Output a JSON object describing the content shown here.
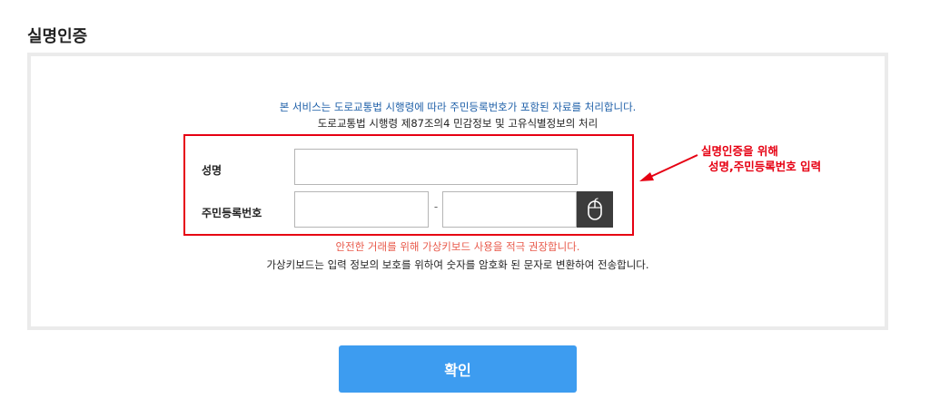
{
  "page": {
    "title": "실명인증"
  },
  "notice": {
    "line1": "본 서비스는 도로교통법 시행령에 따라 주민등록번호가 포함된 자료를 처리합니다.",
    "line2": "도로교통법 시행령 제87조의4 민감정보 및 고유식별정보의 처리"
  },
  "form": {
    "name_label": "성명",
    "name_value": "",
    "rrn_label": "주민등록번호",
    "rrn_front_value": "",
    "rrn_back_value": "",
    "separator": "-",
    "keypad_icon": "mouse-icon"
  },
  "warning": "안전한 거래를 위해 가상키보드 사용을 적극 권장합니다.",
  "info": "가상키보드는 입력 정보의 보호를 위하여 숫자를 암호화 된 문자로 변환하여 전송합니다.",
  "annotation": {
    "line1": "실명인증을 위해",
    "line2": "성명,주민등록번호 입력"
  },
  "confirm_label": "확인",
  "colors": {
    "accent_red": "#e60012",
    "warning_red": "#e8594a",
    "notice_blue": "#1e5fa8",
    "button_blue": "#3d9cf0",
    "keypad_dark": "#3c3c3c"
  }
}
